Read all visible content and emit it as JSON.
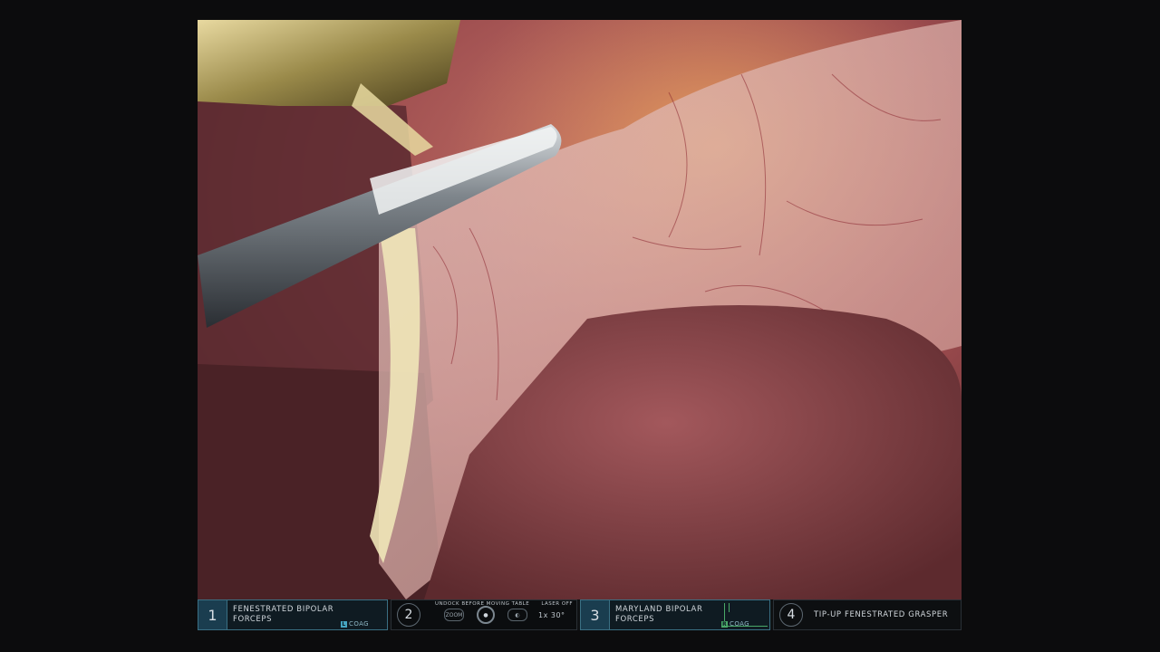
{
  "status_bar": {
    "arms": [
      {
        "number": "1",
        "instrument": "FENESTRATED BIPOLAR FORCEPS",
        "energy_pedal": "L",
        "energy_mode": "COAG"
      },
      {
        "number": "3",
        "instrument": "MARYLAND BIPOLAR FORCEPS",
        "energy_pedal": "R",
        "energy_mode": "COAG"
      },
      {
        "number": "4",
        "instrument": "TIP-UP FENESTRATED GRASPER"
      }
    ],
    "camera": {
      "number": "2",
      "warning": "UNDOCK BEFORE MOVING TABLE",
      "laser": "LASER OFF",
      "zoom_icon_label": "ZOOM",
      "angle": "1x  30°"
    }
  },
  "colors": {
    "active_arm_border": "#3a6f83",
    "active_arm_fill": "#1a3d4f",
    "coag_left": "#46a6c2",
    "coag_right": "#4aa868"
  }
}
